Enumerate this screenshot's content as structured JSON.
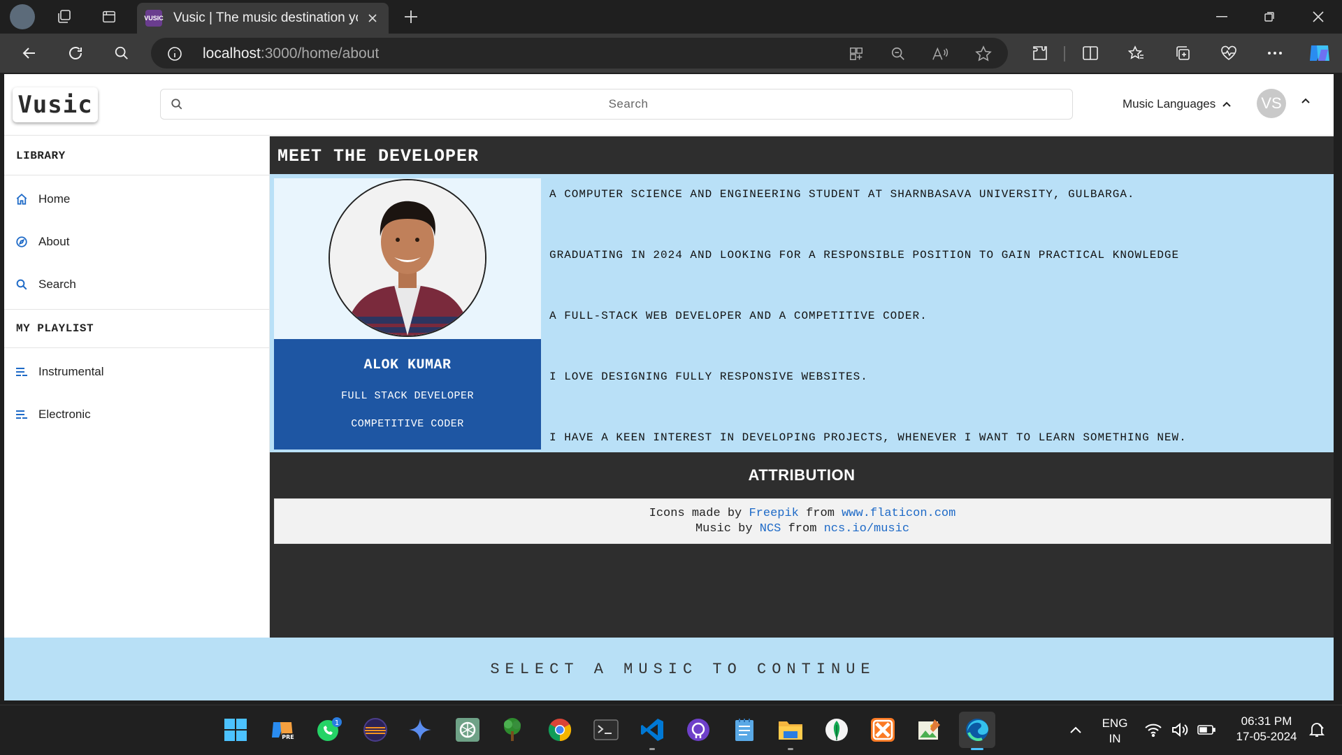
{
  "browser": {
    "tab_title": "Vusic | The music destination you",
    "favicon_text": "VUSIC",
    "url_host": "localhost",
    "url_path": ":3000/home/about"
  },
  "header": {
    "logo_text": "Vusic",
    "search_placeholder": "Search",
    "languages_label": "Music Languages",
    "avatar_initials": "VS"
  },
  "sidebar": {
    "library_heading": "LIBRARY",
    "library_items": [
      {
        "label": "Home",
        "icon": "home-icon"
      },
      {
        "label": "About",
        "icon": "compass-icon"
      },
      {
        "label": "Search",
        "icon": "search-icon"
      }
    ],
    "playlist_heading": "MY PLAYLIST",
    "playlist_items": [
      {
        "label": "Instrumental",
        "icon": "playlist-icon"
      },
      {
        "label": "Electronic",
        "icon": "playlist-icon"
      }
    ]
  },
  "about": {
    "title": "MEET THE DEVELOPER",
    "dev_name": "ALOK KUMAR",
    "dev_role_1": "FULL STACK DEVELOPER",
    "dev_role_2": "COMPETITIVE CODER",
    "facts": [
      "A COMPUTER SCIENCE AND ENGINEERING STUDENT AT SHARNBASAVA UNIVERSITY, GULBARGA.",
      "GRADUATING IN 2024 AND LOOKING FOR A RESPONSIBLE POSITION TO GAIN PRACTICAL KNOWLEDGE",
      "A FULL-STACK WEB DEVELOPER AND A COMPETITIVE CODER.",
      "I LOVE DESIGNING FULLY RESPONSIVE WEBSITES.",
      "I HAVE A KEEN INTEREST IN DEVELOPING PROJECTS, WHENEVER I WANT TO LEARN SOMETHING NEW."
    ]
  },
  "attribution": {
    "title": "ATTRIBUTION",
    "line1_prefix": "Icons made by",
    "line1_author": "Freepik",
    "line1_mid": "from",
    "line1_site": "www.flaticon.com",
    "line2_prefix": "Music by",
    "line2_author": "NCS",
    "line2_mid": "from",
    "line2_site": "ncs.io/music"
  },
  "player": {
    "message": "SELECT A MUSIC TO CONTINUE"
  },
  "taskbar": {
    "whatsapp_badge": "1",
    "lang_line1": "ENG",
    "lang_line2": "IN",
    "time": "06:31 PM",
    "date": "17-05-2024"
  },
  "colors": {
    "main_bg": "#2e2e2e",
    "card_bg": "#b9e0f7",
    "name_panel": "#1e56a3",
    "link": "#1e6ac7"
  }
}
